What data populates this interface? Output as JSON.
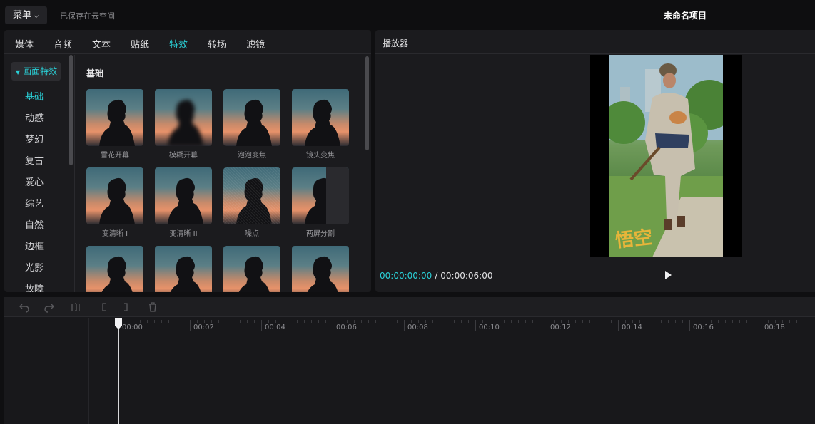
{
  "topbar": {
    "menu_label": "菜单",
    "save_status": "已保存在云空间",
    "project_title": "未命名项目"
  },
  "tabs": [
    {
      "label": "媒体",
      "active": false
    },
    {
      "label": "音频",
      "active": false
    },
    {
      "label": "文本",
      "active": false
    },
    {
      "label": "贴纸",
      "active": false
    },
    {
      "label": "特效",
      "active": true
    },
    {
      "label": "转场",
      "active": false
    },
    {
      "label": "滤镜",
      "active": false
    }
  ],
  "categories": {
    "header": "画面特效",
    "items": [
      "基础",
      "动感",
      "梦幻",
      "复古",
      "爱心",
      "综艺",
      "自然",
      "边框",
      "光影",
      "故障"
    ],
    "active_index": 0
  },
  "effects": {
    "section_title": "基础",
    "items": [
      {
        "label": "雪花开幕"
      },
      {
        "label": "模糊开幕"
      },
      {
        "label": "泡泡变焦"
      },
      {
        "label": "镜头变焦"
      },
      {
        "label": "变清晰 I"
      },
      {
        "label": "变清晰 II"
      },
      {
        "label": "噪点"
      },
      {
        "label": "两屏分割"
      },
      {
        "label": ""
      },
      {
        "label": ""
      },
      {
        "label": ""
      },
      {
        "label": ""
      }
    ]
  },
  "player": {
    "title": "播放器",
    "current_time": "00:00:00:00",
    "separator": "/",
    "total_time": "00:00:06:00",
    "watermark": "悟空"
  },
  "timeline": {
    "ticks": [
      "00:00",
      "00:02",
      "00:04",
      "00:06",
      "00:08",
      "00:10",
      "00:12",
      "00:14",
      "00:16",
      "00:18"
    ]
  },
  "colors": {
    "accent": "#2ad1d8",
    "panel": "#1b1b1e",
    "background": "#0f0f11"
  }
}
